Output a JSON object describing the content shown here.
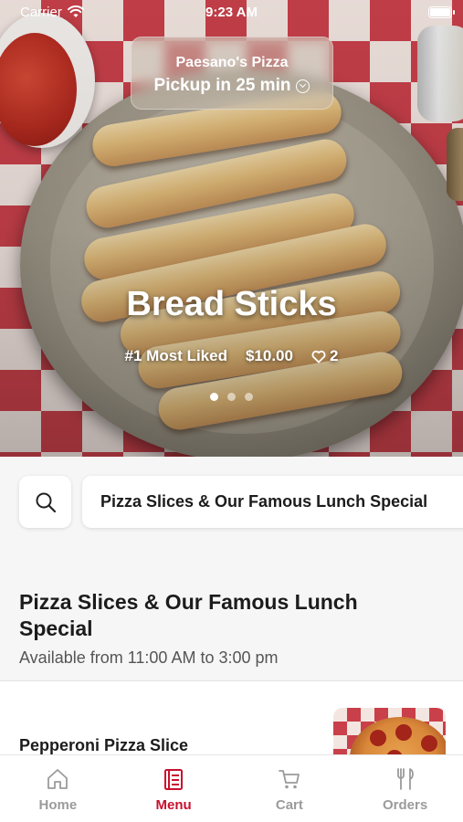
{
  "status_bar": {
    "carrier": "Carrier",
    "time": "9:23 AM"
  },
  "pickup": {
    "store": "Paesano's Pizza",
    "eta": "Pickup in 25 min"
  },
  "hero": {
    "title": "Bread Sticks",
    "rank": "#1 Most Liked",
    "price": "$10.00",
    "likes": "2",
    "slides": 3,
    "active_slide": 1
  },
  "search": {
    "category": "Pizza Slices & Our Famous Lunch Special"
  },
  "section": {
    "title": "Pizza Slices & Our Famous Lunch Special",
    "availability": "Available from 11:00 AM to 3:00 pm"
  },
  "items": [
    {
      "name": "Pepperoni Pizza Slice"
    }
  ],
  "tabs": [
    {
      "label": "Home",
      "icon": "home-icon"
    },
    {
      "label": "Menu",
      "icon": "menu-icon",
      "active": true
    },
    {
      "label": "Cart",
      "icon": "cart-icon"
    },
    {
      "label": "Orders",
      "icon": "orders-icon"
    }
  ],
  "colors": {
    "accent": "#c8102e",
    "inactive_tab": "#9b9b9b"
  }
}
